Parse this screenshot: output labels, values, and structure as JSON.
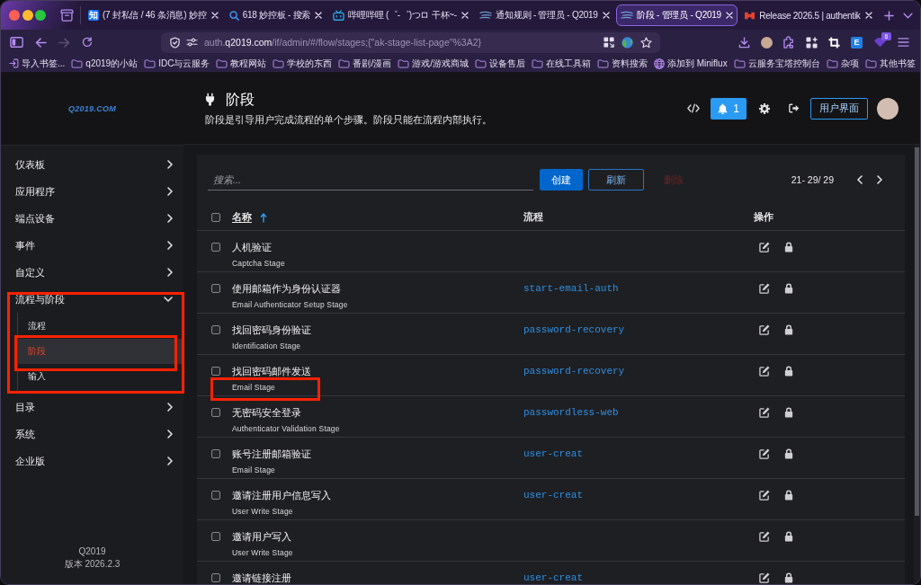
{
  "browser": {
    "tabs": [
      {
        "kind": "letter",
        "icon_text": "知",
        "title": "(7 封私信 / 46 条消息) 妙控",
        "selected": false
      },
      {
        "kind": "search",
        "title": "618 妙控板 - 搜索",
        "selected": false
      },
      {
        "kind": "tv",
        "title": "哔哩哔哩 (゜-゜)つロ 干杯~-",
        "selected": false
      },
      {
        "kind": "swoosh",
        "title": "通知规则 - 管理员 - Q2019",
        "selected": false
      },
      {
        "kind": "swoosh",
        "title": "阶段 - 管理员 - Q2019",
        "selected": true
      },
      {
        "kind": "block",
        "title": "Release 2026.5 | authentik",
        "selected": false
      }
    ],
    "navigation": {
      "back_disabled": false,
      "forward_disabled": true
    },
    "address": {
      "prefix": "auth.",
      "host": "q2019.com",
      "path": "/if/admin/#/flow/stages;{\"ak-stage-list-page\"%3A2}"
    },
    "toolbar": {
      "extension_label": "E",
      "badge_count": "6"
    },
    "bookmarks": [
      {
        "kind": "import",
        "label": "导入书签..."
      },
      {
        "kind": "folder",
        "label": "q2019的小站"
      },
      {
        "kind": "folder",
        "label": "IDC与云服务"
      },
      {
        "kind": "folder",
        "label": "教程网站"
      },
      {
        "kind": "folder",
        "label": "学校的东西"
      },
      {
        "kind": "folder",
        "label": "番剧/漫画"
      },
      {
        "kind": "folder",
        "label": "游戏/游戏商城"
      },
      {
        "kind": "folder",
        "label": "设备售后"
      },
      {
        "kind": "folder",
        "label": "在线工具箱"
      },
      {
        "kind": "folder",
        "label": "资料搜索"
      },
      {
        "kind": "globe",
        "label": "添加到 Miniflux"
      },
      {
        "kind": "folder",
        "label": "云服务宝塔控制台"
      },
      {
        "kind": "folder",
        "label": "杂项"
      }
    ],
    "other_bookmarks": {
      "kind": "folder",
      "label": "其他书签"
    }
  },
  "sidebar": {
    "logo": "Q2019.COM",
    "items": [
      {
        "label": "仪表板",
        "expanded": false,
        "highlighted": false
      },
      {
        "label": "应用程序",
        "expanded": false,
        "highlighted": false
      },
      {
        "label": "端点设备",
        "expanded": false,
        "highlighted": false
      },
      {
        "label": "事件",
        "expanded": false,
        "highlighted": false
      },
      {
        "label": "自定义",
        "expanded": false,
        "highlighted": false
      },
      {
        "label": "流程与阶段",
        "expanded": true,
        "highlighted": true,
        "children": [
          {
            "label": "流程",
            "selected": false,
            "highlighted": false
          },
          {
            "label": "阶段",
            "selected": true,
            "highlighted": true
          },
          {
            "label": "输入",
            "selected": false,
            "highlighted": false
          }
        ]
      },
      {
        "label": "目录",
        "expanded": false,
        "highlighted": false
      },
      {
        "label": "系统",
        "expanded": false,
        "highlighted": false
      },
      {
        "label": "企业版",
        "expanded": false,
        "highlighted": false
      }
    ],
    "brand": "Q2019",
    "version": "版本 2026.2.3"
  },
  "page_header": {
    "title": "阶段",
    "description": "阶段是引导用户完成流程的单个步骤。阶段只能在流程内部执行。",
    "notification_count": "1",
    "user_interface_button": "用户界面"
  },
  "stage_list": {
    "search": {
      "placeholder": "搜索..."
    },
    "buttons": [
      {
        "label": "创建",
        "kind": "primary",
        "disabled": false
      },
      {
        "label": "刷新",
        "kind": "secondary",
        "disabled": false
      },
      {
        "label": "删除",
        "kind": "danger",
        "disabled": true
      }
    ],
    "pagination": "21- 29/ 29",
    "select_all": {
      "checked": false
    },
    "columns": [
      {
        "label": "名称",
        "sorted_ascending": true
      },
      {
        "label": "流程",
        "sorted_ascending": false
      },
      {
        "label": "操作",
        "sorted_ascending": false
      }
    ],
    "rows": [
      {
        "name": "人机验证",
        "type": "Captcha Stage",
        "checked": false,
        "highlighted": false
      },
      {
        "name": "使用邮箱作为身份认证器",
        "type": "Email Authenticator Setup Stage",
        "flow": "start-email-auth",
        "checked": false,
        "highlighted": false
      },
      {
        "name": "找回密码身份验证",
        "type": "Identification Stage",
        "flow": "password-recovery",
        "checked": false,
        "highlighted": false
      },
      {
        "name": "找回密码邮件发送",
        "type": "Email Stage",
        "flow": "password-recovery",
        "checked": false,
        "highlighted": true
      },
      {
        "name": "无密码安全登录",
        "type": "Authenticator Validation Stage",
        "flow": "passwordless-web",
        "checked": false,
        "highlighted": false
      },
      {
        "name": "账号注册邮箱验证",
        "type": "Email Stage",
        "flow": "user-creat",
        "checked": false,
        "highlighted": false
      },
      {
        "name": "邀请注册用户信息写入",
        "type": "User Write Stage",
        "flow": "user-creat",
        "checked": false,
        "highlighted": false
      },
      {
        "name": "邀请用户写入",
        "type": "User Write Stage",
        "checked": false,
        "highlighted": false
      },
      {
        "name": "邀请链接注册",
        "flow": "user-creat",
        "checked": false,
        "highlighted": false
      }
    ]
  }
}
